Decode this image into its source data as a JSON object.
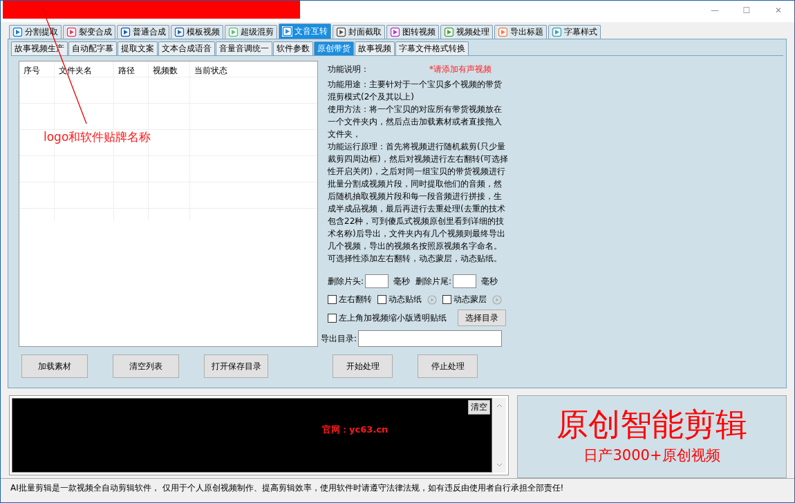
{
  "window": {
    "controls": [
      "—",
      "☐",
      "✕"
    ]
  },
  "main_tabs": [
    {
      "label": "分割提取",
      "selected": false
    },
    {
      "label": "裂变合成",
      "selected": false
    },
    {
      "label": "普通合成",
      "selected": false
    },
    {
      "label": "模板视频",
      "selected": false
    },
    {
      "label": "超级混剪",
      "selected": false
    },
    {
      "label": "文音互转",
      "selected": true
    },
    {
      "label": "封面截取",
      "selected": false
    },
    {
      "label": "图转视频",
      "selected": false
    },
    {
      "label": "视频处理",
      "selected": false
    },
    {
      "label": "导出标题",
      "selected": false
    },
    {
      "label": "字幕样式",
      "selected": false
    }
  ],
  "sub_tabs": [
    {
      "label": "故事视频生产",
      "selected": false
    },
    {
      "label": "自动配字幕",
      "selected": false
    },
    {
      "label": "提取文案",
      "selected": false
    },
    {
      "label": "文本合成语音",
      "selected": false
    },
    {
      "label": "音量音调统一",
      "selected": false
    },
    {
      "label": "软件参数",
      "selected": false
    },
    {
      "label": "原创带货",
      "selected": true
    },
    {
      "label": "故事视频",
      "selected": false
    },
    {
      "label": "字幕文件格式转换",
      "selected": false
    }
  ],
  "table": {
    "columns": [
      "序号",
      "文件夹名",
      "路径",
      "视频数",
      "当前状态"
    ]
  },
  "description": {
    "title": "功能说明：",
    "notice": "*请添加有声视频",
    "paragraphs": [
      "功能用途：主要针对于一个宝贝多个视频的带货混剪模式(2个及其以上)",
      "使用方法：将一个宝贝的对应所有带货视频放在一个文件夹内，然后点击加载素材或者直接拖入文件夹，",
      "功能运行原理：首先将视频进行随机裁剪(只少量裁剪四周边框)，然后对视频进行左右翻转(可选择性开启关闭)，之后对同一组宝贝的带货视频进行批量分割成视频片段，同时提取他们的音频，然后随机抽取视频片段和每一段音频进行拼接，生成半成品视频，最后再进行去重处理(去重的技术包含22种，可到傻瓜式视频原创里看到详细的技术名称)后导出，文件夹内有几个视频则最终导出几个视频，导出的视频名按照原视频名字命名。可选择性添加左右翻转，动态蒙层，动态贴纸。"
    ]
  },
  "trim": {
    "head_label": "删除片头:",
    "head_unit": "毫秒",
    "tail_label": "删除片尾:",
    "tail_unit": "毫秒"
  },
  "options": [
    {
      "label": "左右翻转",
      "checked": false,
      "play_icon": false
    },
    {
      "label": "动态贴纸",
      "checked": false,
      "play_icon": true
    },
    {
      "label": "动态蒙层",
      "checked": false,
      "play_icon": true
    }
  ],
  "sticker_option": {
    "label": "左上角加视频缩小版透明贴纸",
    "checked": false
  },
  "choose_dir_button": "选择目录",
  "export_dir": {
    "label": "导出目录:"
  },
  "buttons": [
    "加载素材",
    "清空列表",
    "打开保存目录",
    "开始处理",
    "停止处理"
  ],
  "log": {
    "clear_button": "清空",
    "website": "官网：yc63.cn"
  },
  "promo": {
    "title": "原创智能剪辑",
    "subtitle": "日产3000+原创视频"
  },
  "annotation": {
    "text": "logo和软件贴牌名称"
  },
  "status_bar": "AI批量剪辑是一款视频全自动剪辑软件， 仅用于个人原创视频制作、提高剪辑效率，使用软件时请遵守法律法规，如有违反由使用者自行承担全部责任!"
}
